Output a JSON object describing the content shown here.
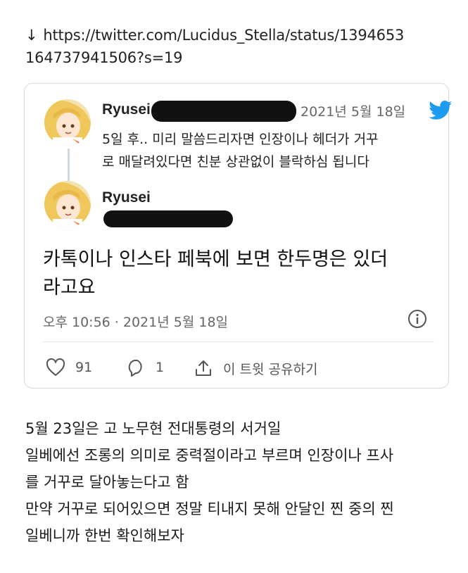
{
  "header": {
    "arrow": "↓",
    "url_line1": "https://twitter.com/Lucidus_Stella/status/1394653",
    "url_line2": "164737941506?s=19"
  },
  "tweet_reply": {
    "author": "Ryusei",
    "date": "2021년 5월 18일",
    "text_line1": "5일 후.. 미리 말씀드리자면 인장이나 헤더가 거꾸",
    "text_line2": "로 매달려있다면 친분 상관없이 블락하심 됩니다"
  },
  "tweet_main": {
    "author": "Ryusei",
    "text_line1": "카톡이나 인스타 페북에 보면 한두명은 있더",
    "text_line2": "라고요",
    "timestamp": "오후 10:56 · 2021년 5월 18일"
  },
  "actions": {
    "likes": "91",
    "replies": "1",
    "share_label": "이 트윗 공유하기"
  },
  "caption": {
    "line1": "5월 23일은 고 노무현 전대통령의 서거일",
    "line2": "일베에선 조롱의 의미로 중력절이라고 부르며 인장이나 프사",
    "line3": "를 거꾸로 달아놓는다고 함",
    "line4": "만약 거꾸로 되어있으면 정말 티내지 못해 안달인 찐 중의 찐",
    "line5": "일베니까 한번 확인해보자"
  },
  "colors": {
    "twitter_blue": "#1d9bf0",
    "meta_gray": "#666666",
    "border": "#d6dbe0"
  }
}
